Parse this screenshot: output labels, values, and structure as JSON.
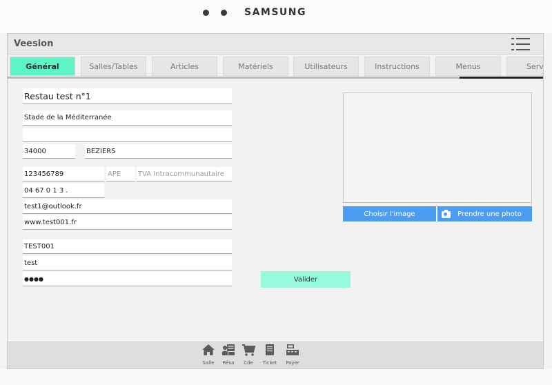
{
  "device": {
    "brand": "SAMSUNG"
  },
  "app": {
    "title": "Veesion"
  },
  "tabs": [
    {
      "label": "Général",
      "active": true
    },
    {
      "label": "Salles/Tables"
    },
    {
      "label": "Articles"
    },
    {
      "label": "Matériels"
    },
    {
      "label": "Utilisateurs"
    },
    {
      "label": "Instructions"
    },
    {
      "label": "Menus"
    },
    {
      "label": "Servi"
    }
  ],
  "form": {
    "name": "Restau test n°1",
    "address1": "Stade de la Méditerranée",
    "address2": "",
    "postal_code": "34000",
    "city": "BEZIERS",
    "siret": "123456789",
    "ape_placeholder": "APE",
    "tva_placeholder": "TVA Intracommunautaire",
    "phone": "04 67 0 1 3 .",
    "email": "test1@outlook.fr",
    "website": "www.test001.fr",
    "login": "TEST001",
    "user": "test",
    "password": "●●●●"
  },
  "image": {
    "choose_label": "Choisir l'image",
    "photo_label": "Prendre une photo"
  },
  "actions": {
    "validate_label": "Valider"
  },
  "bottom_nav": [
    {
      "label": "Salle",
      "icon": "home-icon"
    },
    {
      "label": "Résa",
      "icon": "reservation-icon"
    },
    {
      "label": "Cde",
      "icon": "cart-icon"
    },
    {
      "label": "Ticket",
      "icon": "ticket-icon"
    },
    {
      "label": "Payer",
      "icon": "register-icon"
    }
  ],
  "colors": {
    "active_tab": "#5ef5c6",
    "primary_button": "#4a9df0",
    "validate_button": "#96fbdc"
  }
}
